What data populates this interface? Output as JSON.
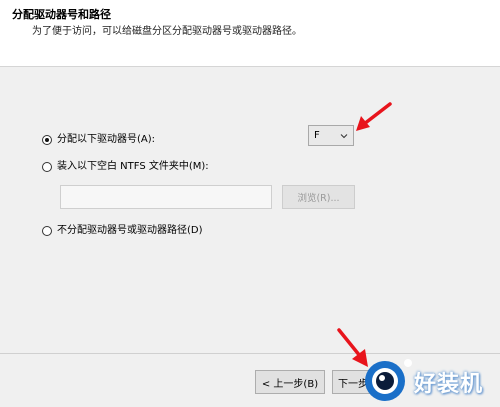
{
  "header": {
    "title": "分配驱动器号和路径",
    "subtitle": "为了便于访问，可以给磁盘分区分配驱动器号或驱动器路径。"
  },
  "options": {
    "assign_letter": "分配以下驱动器号(A):",
    "mount_folder": "装入以下空白 NTFS 文件夹中(M):",
    "no_letter": "不分配驱动器号或驱动器路径(D)"
  },
  "drive_select": {
    "selected": "F"
  },
  "path_input": {
    "value": ""
  },
  "buttons": {
    "browse": "浏览(R)...",
    "back": "< 上一步(B)",
    "next": "下一步"
  },
  "watermark": {
    "text": "好装机",
    "icon": "eye-logo-icon"
  },
  "colors": {
    "arrow": "#e8141c",
    "watermark_blue": "#1a6fc8"
  }
}
